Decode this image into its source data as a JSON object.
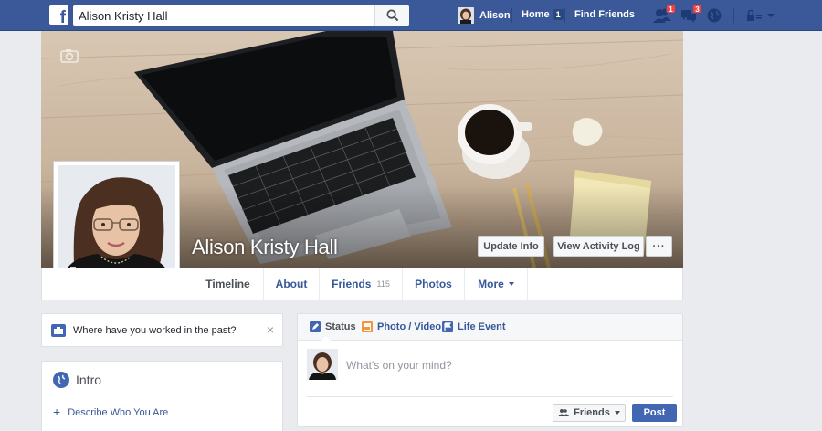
{
  "topbar": {
    "logo": "f",
    "search": {
      "value": "Alison Kristy Hall",
      "icon": "search-icon"
    },
    "user": {
      "name": "Alison"
    },
    "home": {
      "label": "Home",
      "count": "1"
    },
    "find_friends": "Find Friends",
    "friend_requests_count": "1",
    "messages_count": "3",
    "colors": {
      "bar": "#3b5998",
      "badge": "#fa3e3e"
    }
  },
  "profile": {
    "name": "Alison Kristy Hall",
    "update_info": "Update Info",
    "view_activity_log": "View Activity Log",
    "more_dots": "···"
  },
  "tabs": [
    {
      "label": "Timeline"
    },
    {
      "label": "About"
    },
    {
      "label": "Friends",
      "count": "115"
    },
    {
      "label": "Photos"
    },
    {
      "label": "More"
    }
  ],
  "work_prompt": {
    "text": "Where have you worked in the past?",
    "close": "×"
  },
  "intro": {
    "title": "Intro",
    "link": "Describe Who You Are"
  },
  "composer": {
    "tabs": [
      {
        "label": "Status"
      },
      {
        "label": "Photo / Video"
      },
      {
        "label": "Life Event"
      }
    ],
    "placeholder": "What's on your mind?",
    "audience": "Friends",
    "post": "Post"
  }
}
